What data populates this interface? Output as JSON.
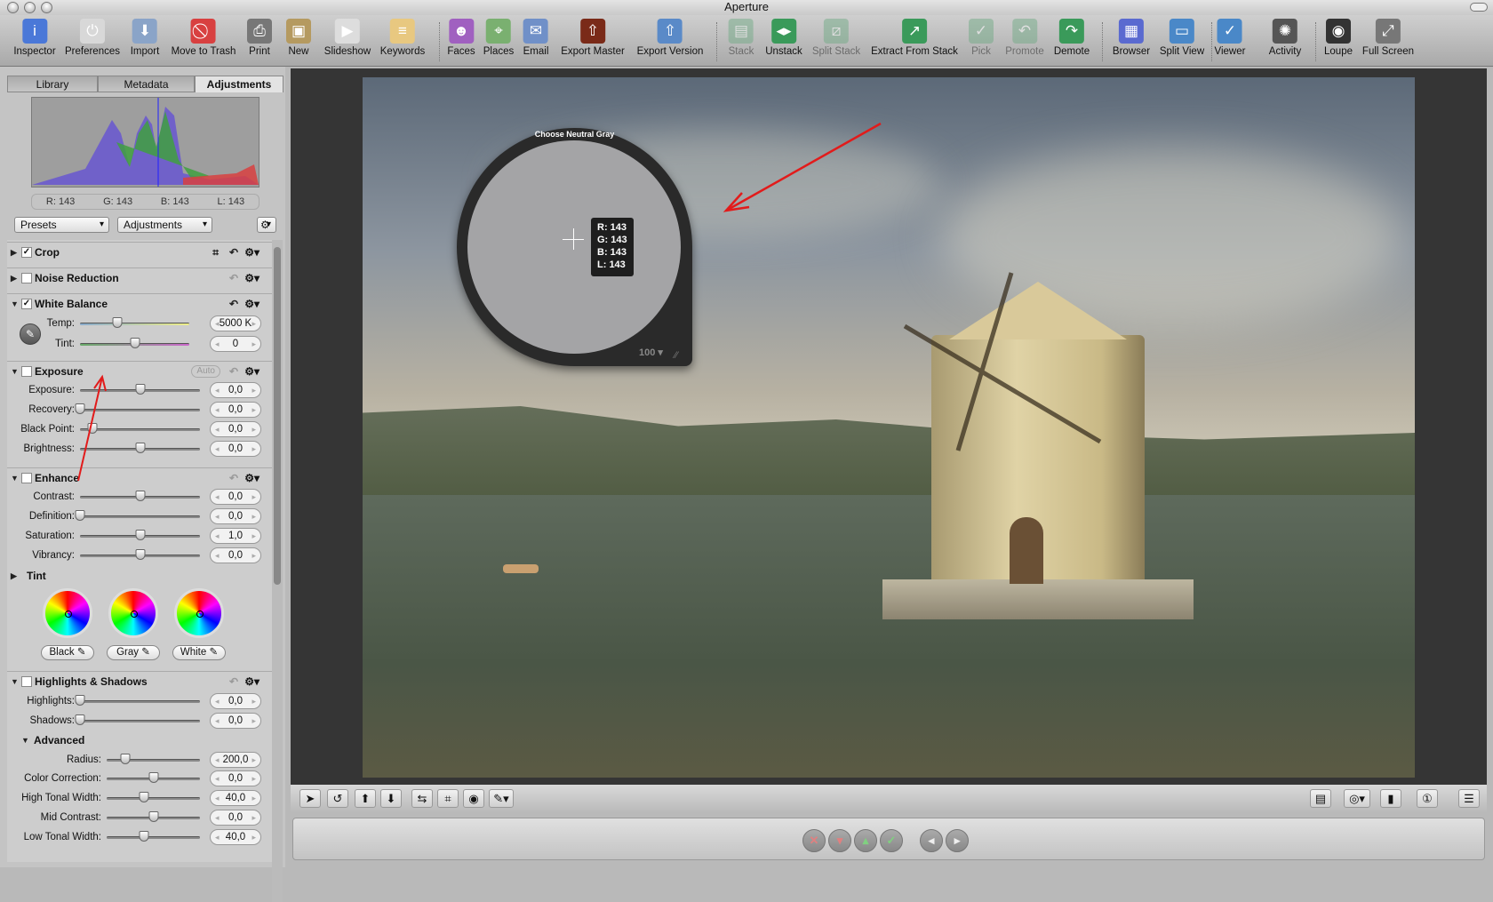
{
  "window": {
    "title": "Aperture"
  },
  "toolbar": [
    {
      "label": "Inspector",
      "icon": "info-icon",
      "color": "#4a78d8",
      "glyph": "i"
    },
    {
      "label": "Preferences",
      "icon": "switch-icon",
      "color": "#d8d8d8",
      "glyph": "⏻"
    },
    {
      "label": "Import",
      "icon": "import-arrow-icon",
      "color": "#8aa4c8",
      "glyph": "⬇"
    },
    {
      "label": "Move to Trash",
      "icon": "no-entry-icon",
      "color": "#d84040",
      "glyph": "⃠"
    },
    {
      "label": "Print",
      "icon": "printer-icon",
      "color": "#777",
      "glyph": "⎙"
    },
    {
      "label": "New",
      "icon": "new-box-icon",
      "color": "#b59a60",
      "glyph": "▣"
    },
    {
      "label": "Slideshow",
      "icon": "play-icon",
      "color": "#ddd",
      "glyph": "▶"
    },
    {
      "label": "Keywords",
      "icon": "tag-icon",
      "color": "#e8c880",
      "glyph": "≡"
    },
    {
      "label": "Faces",
      "icon": "faces-icon",
      "color": "#a060c0",
      "glyph": "☻"
    },
    {
      "label": "Places",
      "icon": "map-icon",
      "color": "#7ab070",
      "glyph": "⌖"
    },
    {
      "label": "Email",
      "icon": "stamp-icon",
      "color": "#7090c8",
      "glyph": "✉"
    },
    {
      "label": "Export Master",
      "icon": "export-master-icon",
      "color": "#7a2a18",
      "glyph": "⇧"
    },
    {
      "label": "Export Version",
      "icon": "export-version-icon",
      "color": "#5a8ac8",
      "glyph": "⇧"
    },
    {
      "label": "Stack",
      "icon": "stack-icon",
      "color": "#6aa880",
      "glyph": "▤",
      "disabled": true
    },
    {
      "label": "Unstack",
      "icon": "unstack-icon",
      "color": "#3a9a5a",
      "glyph": "◂▸"
    },
    {
      "label": "Split Stack",
      "icon": "split-stack-icon",
      "color": "#6aa880",
      "glyph": "⧄",
      "disabled": true
    },
    {
      "label": "Extract From Stack",
      "icon": "extract-icon",
      "color": "#3a9a5a",
      "glyph": "↗"
    },
    {
      "label": "Pick",
      "icon": "pick-icon",
      "color": "#6aa880",
      "glyph": "✓",
      "disabled": true
    },
    {
      "label": "Promote",
      "icon": "promote-icon",
      "color": "#6aa880",
      "glyph": "↶",
      "disabled": true
    },
    {
      "label": "Demote",
      "icon": "demote-icon",
      "color": "#3a9a5a",
      "glyph": "↷"
    },
    {
      "label": "Browser",
      "icon": "grid-icon",
      "color": "#5a6ad0",
      "glyph": "▦"
    },
    {
      "label": "Split View",
      "icon": "split-view-icon",
      "color": "#4a88c8",
      "glyph": "▭"
    },
    {
      "label": "Viewer",
      "icon": "viewer-icon",
      "color": "#4a88c8",
      "glyph": "✓"
    },
    {
      "label": "Activity",
      "icon": "activity-icon",
      "color": "#555",
      "glyph": "✺"
    },
    {
      "label": "Loupe",
      "icon": "loupe-icon",
      "color": "#333",
      "glyph": "◉"
    },
    {
      "label": "Full Screen",
      "icon": "full-screen-icon",
      "color": "#777",
      "glyph": "⤢"
    }
  ],
  "tabs": [
    {
      "label": "Library"
    },
    {
      "label": "Metadata"
    },
    {
      "label": "Adjustments",
      "active": true
    }
  ],
  "histogram_readout": {
    "r": "R: 143",
    "g": "G: 143",
    "b": "B: 143",
    "l": "L: 143"
  },
  "presets_label": "Presets",
  "adjustments_label": "Adjustments",
  "sections": {
    "crop": {
      "title": "Crop",
      "checked": true,
      "expanded": false
    },
    "noise": {
      "title": "Noise Reduction",
      "checked": false,
      "expanded": false
    },
    "wb": {
      "title": "White Balance",
      "checked": true,
      "expanded": true
    },
    "exposure": {
      "title": "Exposure",
      "checked": false,
      "expanded": true,
      "auto_label": "Auto"
    },
    "enhance": {
      "title": "Enhance",
      "checked": false,
      "expanded": true
    },
    "tint": {
      "title": "Tint",
      "wheels": [
        {
          "label": "Black"
        },
        {
          "label": "Gray"
        },
        {
          "label": "White"
        }
      ]
    },
    "hs": {
      "title": "Highlights & Shadows",
      "checked": false,
      "expanded": true
    },
    "advanced": {
      "title": "Advanced"
    }
  },
  "sliders": [
    {
      "label": "Temp:",
      "value": "5000 K",
      "level": 0.34
    },
    {
      "label": "Tint:",
      "value": "0",
      "level": 0.5
    },
    {
      "label": "Exposure:",
      "value": "0,0",
      "level": 0.5
    },
    {
      "label": "Recovery:",
      "value": "0,0",
      "level": 0.0
    },
    {
      "label": "Black Point:",
      "value": "0,0",
      "level": 0.1
    },
    {
      "label": "Brightness:",
      "value": "0,0",
      "level": 0.5
    },
    {
      "label": "Contrast:",
      "value": "0,0",
      "level": 0.5
    },
    {
      "label": "Definition:",
      "value": "0,0",
      "level": 0.0
    },
    {
      "label": "Saturation:",
      "value": "1,0",
      "level": 0.5
    },
    {
      "label": "Vibrancy:",
      "value": "0,0",
      "level": 0.5
    },
    {
      "label": "Highlights:",
      "value": "0,0",
      "level": 0.0
    },
    {
      "label": "Shadows:",
      "value": "0,0",
      "level": 0.0
    },
    {
      "label": "Radius:",
      "value": "200,0",
      "level": 0.2
    },
    {
      "label": "Color Correction:",
      "value": "0,0",
      "level": 0.5
    },
    {
      "label": "High Tonal Width:",
      "value": "40,0",
      "level": 0.4
    },
    {
      "label": "Mid Contrast:",
      "value": "0,0",
      "level": 0.5
    },
    {
      "label": "Low Tonal Width:",
      "value": "40,0",
      "level": 0.4
    }
  ],
  "loupe": {
    "title": "Choose Neutral Gray",
    "r": "R: 143",
    "g": "G: 143",
    "b": "B: 143",
    "l": "L: 143",
    "zoom": "100"
  },
  "colors": {
    "annotation_arrow": "#e21b1b",
    "viewer_bg": "#353535"
  }
}
